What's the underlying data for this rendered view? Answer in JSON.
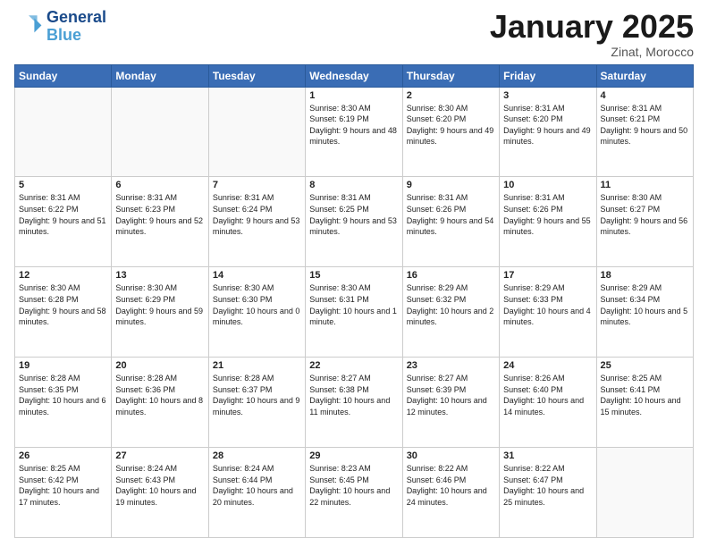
{
  "header": {
    "logo_line1": "General",
    "logo_line2": "Blue",
    "month": "January 2025",
    "location": "Zinat, Morocco"
  },
  "days_header": [
    "Sunday",
    "Monday",
    "Tuesday",
    "Wednesday",
    "Thursday",
    "Friday",
    "Saturday"
  ],
  "weeks": [
    [
      {
        "day": "",
        "info": ""
      },
      {
        "day": "",
        "info": ""
      },
      {
        "day": "",
        "info": ""
      },
      {
        "day": "1",
        "info": "Sunrise: 8:30 AM\nSunset: 6:19 PM\nDaylight: 9 hours and 48 minutes."
      },
      {
        "day": "2",
        "info": "Sunrise: 8:30 AM\nSunset: 6:20 PM\nDaylight: 9 hours and 49 minutes."
      },
      {
        "day": "3",
        "info": "Sunrise: 8:31 AM\nSunset: 6:20 PM\nDaylight: 9 hours and 49 minutes."
      },
      {
        "day": "4",
        "info": "Sunrise: 8:31 AM\nSunset: 6:21 PM\nDaylight: 9 hours and 50 minutes."
      }
    ],
    [
      {
        "day": "5",
        "info": "Sunrise: 8:31 AM\nSunset: 6:22 PM\nDaylight: 9 hours and 51 minutes."
      },
      {
        "day": "6",
        "info": "Sunrise: 8:31 AM\nSunset: 6:23 PM\nDaylight: 9 hours and 52 minutes."
      },
      {
        "day": "7",
        "info": "Sunrise: 8:31 AM\nSunset: 6:24 PM\nDaylight: 9 hours and 53 minutes."
      },
      {
        "day": "8",
        "info": "Sunrise: 8:31 AM\nSunset: 6:25 PM\nDaylight: 9 hours and 53 minutes."
      },
      {
        "day": "9",
        "info": "Sunrise: 8:31 AM\nSunset: 6:26 PM\nDaylight: 9 hours and 54 minutes."
      },
      {
        "day": "10",
        "info": "Sunrise: 8:31 AM\nSunset: 6:26 PM\nDaylight: 9 hours and 55 minutes."
      },
      {
        "day": "11",
        "info": "Sunrise: 8:30 AM\nSunset: 6:27 PM\nDaylight: 9 hours and 56 minutes."
      }
    ],
    [
      {
        "day": "12",
        "info": "Sunrise: 8:30 AM\nSunset: 6:28 PM\nDaylight: 9 hours and 58 minutes."
      },
      {
        "day": "13",
        "info": "Sunrise: 8:30 AM\nSunset: 6:29 PM\nDaylight: 9 hours and 59 minutes."
      },
      {
        "day": "14",
        "info": "Sunrise: 8:30 AM\nSunset: 6:30 PM\nDaylight: 10 hours and 0 minutes."
      },
      {
        "day": "15",
        "info": "Sunrise: 8:30 AM\nSunset: 6:31 PM\nDaylight: 10 hours and 1 minute."
      },
      {
        "day": "16",
        "info": "Sunrise: 8:29 AM\nSunset: 6:32 PM\nDaylight: 10 hours and 2 minutes."
      },
      {
        "day": "17",
        "info": "Sunrise: 8:29 AM\nSunset: 6:33 PM\nDaylight: 10 hours and 4 minutes."
      },
      {
        "day": "18",
        "info": "Sunrise: 8:29 AM\nSunset: 6:34 PM\nDaylight: 10 hours and 5 minutes."
      }
    ],
    [
      {
        "day": "19",
        "info": "Sunrise: 8:28 AM\nSunset: 6:35 PM\nDaylight: 10 hours and 6 minutes."
      },
      {
        "day": "20",
        "info": "Sunrise: 8:28 AM\nSunset: 6:36 PM\nDaylight: 10 hours and 8 minutes."
      },
      {
        "day": "21",
        "info": "Sunrise: 8:28 AM\nSunset: 6:37 PM\nDaylight: 10 hours and 9 minutes."
      },
      {
        "day": "22",
        "info": "Sunrise: 8:27 AM\nSunset: 6:38 PM\nDaylight: 10 hours and 11 minutes."
      },
      {
        "day": "23",
        "info": "Sunrise: 8:27 AM\nSunset: 6:39 PM\nDaylight: 10 hours and 12 minutes."
      },
      {
        "day": "24",
        "info": "Sunrise: 8:26 AM\nSunset: 6:40 PM\nDaylight: 10 hours and 14 minutes."
      },
      {
        "day": "25",
        "info": "Sunrise: 8:25 AM\nSunset: 6:41 PM\nDaylight: 10 hours and 15 minutes."
      }
    ],
    [
      {
        "day": "26",
        "info": "Sunrise: 8:25 AM\nSunset: 6:42 PM\nDaylight: 10 hours and 17 minutes."
      },
      {
        "day": "27",
        "info": "Sunrise: 8:24 AM\nSunset: 6:43 PM\nDaylight: 10 hours and 19 minutes."
      },
      {
        "day": "28",
        "info": "Sunrise: 8:24 AM\nSunset: 6:44 PM\nDaylight: 10 hours and 20 minutes."
      },
      {
        "day": "29",
        "info": "Sunrise: 8:23 AM\nSunset: 6:45 PM\nDaylight: 10 hours and 22 minutes."
      },
      {
        "day": "30",
        "info": "Sunrise: 8:22 AM\nSunset: 6:46 PM\nDaylight: 10 hours and 24 minutes."
      },
      {
        "day": "31",
        "info": "Sunrise: 8:22 AM\nSunset: 6:47 PM\nDaylight: 10 hours and 25 minutes."
      },
      {
        "day": "",
        "info": ""
      }
    ]
  ]
}
